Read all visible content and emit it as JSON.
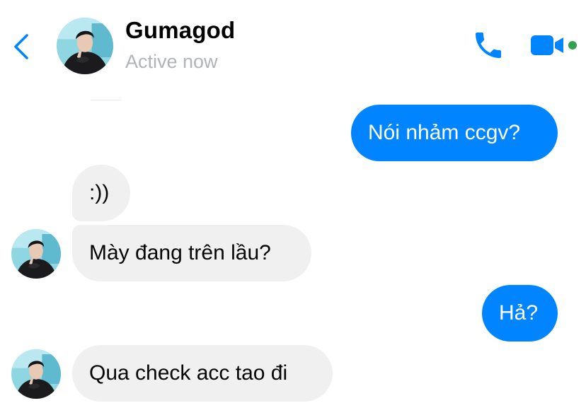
{
  "header": {
    "contact_name": "Gumagod",
    "status": "Active now",
    "icons": {
      "back": "chevron-left-icon",
      "call": "phone-icon",
      "video": "video-camera-icon"
    },
    "colors": {
      "accent": "#0084ff",
      "active_dot": "#31a24c",
      "status_text": "#b0b3b8"
    }
  },
  "messages": [
    {
      "direction": "outgoing",
      "text": "Nói nhảm ccgv?"
    },
    {
      "direction": "incoming",
      "text": ":))"
    },
    {
      "direction": "incoming",
      "text": "Mày đang trên lầu?"
    },
    {
      "direction": "outgoing",
      "text": "Hả?"
    },
    {
      "direction": "incoming",
      "text": "Qua check acc tao đi"
    }
  ],
  "colors": {
    "outgoing_bubble": "#0084ff",
    "incoming_bubble": "#f0f0f0"
  }
}
